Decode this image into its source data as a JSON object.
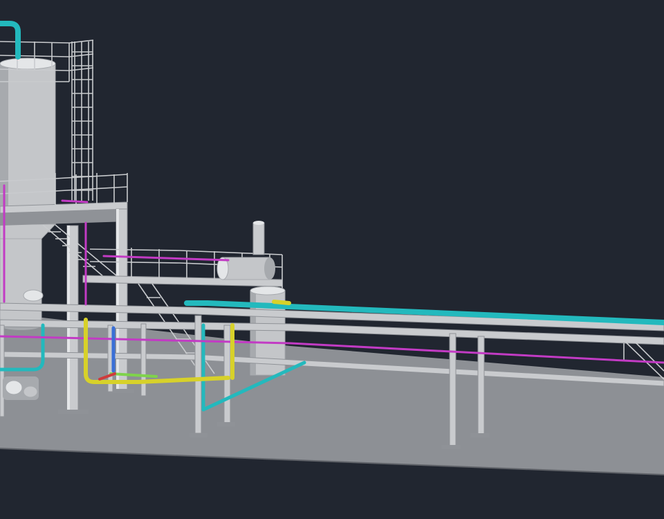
{
  "viewport": {
    "kind": "3d-plant-model",
    "icon": "plant-model-icon"
  },
  "colors": {
    "background": "#212630",
    "ground": "#8d9095",
    "ground_edge": "#5f6268",
    "steel": "#c9cbce",
    "steel_dark": "#8f9297",
    "steel_light": "#e4e6e8",
    "vessel": "#c4c6c9",
    "vessel_shade": "#a7aaae",
    "pipe_cyan": "#23b9bd",
    "pipe_magenta": "#c23bc4",
    "pipe_yellow": "#d7d12a",
    "pipe_green": "#7fd34b",
    "pipe_blue": "#3a6fd6",
    "pipe_red": "#cf3b3b"
  },
  "scene": {
    "equipment": [
      {
        "id": "tall-column",
        "kind": "vessel"
      },
      {
        "id": "drum",
        "kind": "vessel"
      },
      {
        "id": "horizontal-exchanger",
        "kind": "vessel"
      },
      {
        "id": "cage-ladder",
        "kind": "ladder"
      },
      {
        "id": "pipe-rack",
        "kind": "structure"
      },
      {
        "id": "stair",
        "kind": "structure"
      }
    ]
  }
}
